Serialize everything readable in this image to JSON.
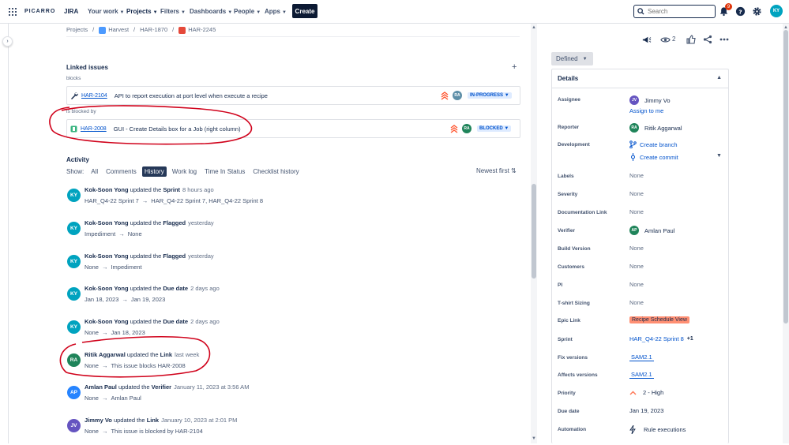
{
  "topnav": {
    "brand": "PICARRO",
    "product": "JIRA",
    "items": [
      {
        "label": "Your work"
      },
      {
        "label": "Projects"
      },
      {
        "label": "Filters"
      },
      {
        "label": "Dashboards"
      },
      {
        "label": "People"
      },
      {
        "label": "Apps"
      }
    ],
    "create_label": "Create",
    "search_placeholder": "Search",
    "notification_count": "9",
    "avatar_initials": "KY"
  },
  "breadcrumb": {
    "items": [
      "Projects",
      "Harvest",
      "HAR-1870",
      "HAR-2245"
    ]
  },
  "linked_issues": {
    "title": "Linked issues",
    "groups": [
      {
        "label": "blocks",
        "issue_key": "HAR-2104",
        "summary": "API to report execution at port level when execute a recipe",
        "assignee_initials": "RA",
        "status": "IN-PROGRESS"
      },
      {
        "label": "is blocked by",
        "issue_key": "HAR-2008",
        "summary": "GUI - Create Details box for a Job (right column)",
        "assignee_initials": "RA",
        "status": "BLOCKED"
      }
    ]
  },
  "activity": {
    "title": "Activity",
    "show_label": "Show:",
    "filters": [
      "All",
      "Comments",
      "History",
      "Work log",
      "Time In Status",
      "Checklist history"
    ],
    "active_filter": "History",
    "sort_label": "Newest first",
    "items": [
      {
        "initials": "KY",
        "color": "#00a3bf",
        "who": "Kok-Soon Yong",
        "verb": "updated the",
        "field": "Sprint",
        "when": "8 hours ago",
        "from": "HAR_Q4-22 Sprint 7",
        "to": "HAR_Q4-22 Sprint 7, HAR_Q4-22 Sprint 8"
      },
      {
        "initials": "KY",
        "color": "#00a3bf",
        "who": "Kok-Soon Yong",
        "verb": "updated the",
        "field": "Flagged",
        "when": "yesterday",
        "from": "Impediment",
        "to": "None"
      },
      {
        "initials": "KY",
        "color": "#00a3bf",
        "who": "Kok-Soon Yong",
        "verb": "updated the",
        "field": "Flagged",
        "when": "yesterday",
        "from": "None",
        "to": "Impediment"
      },
      {
        "initials": "KY",
        "color": "#00a3bf",
        "who": "Kok-Soon Yong",
        "verb": "updated the",
        "field": "Due date",
        "when": "2 days ago",
        "from": "Jan 18, 2023",
        "to": "Jan 19, 2023"
      },
      {
        "initials": "KY",
        "color": "#00a3bf",
        "who": "Kok-Soon Yong",
        "verb": "updated the",
        "field": "Due date",
        "when": "2 days ago",
        "from": "None",
        "to": "Jan 18, 2023"
      },
      {
        "initials": "RA",
        "color": "#1f845a",
        "who": "Ritik Aggarwal",
        "verb": "updated the",
        "field": "Link",
        "when": "last week",
        "from": "None",
        "to": "This issue blocks HAR-2008"
      },
      {
        "initials": "AP",
        "color": "#2684ff",
        "who": "Amlan Paul",
        "verb": "updated the",
        "field": "Verifier",
        "when": "January 11, 2023 at 3:56 AM",
        "from": "None",
        "to": "Amlan Paul"
      },
      {
        "initials": "JV",
        "color": "#6554c0",
        "who": "Jimmy Vo",
        "verb": "updated the",
        "field": "Link",
        "when": "January 10, 2023 at 2:01 PM",
        "from": "None",
        "to": "This issue is blocked by HAR-2104"
      }
    ]
  },
  "toolbar": {
    "watch_count": "2"
  },
  "status_button": {
    "label": "Defined"
  },
  "details": {
    "title": "Details",
    "assignee": {
      "label": "Assignee",
      "name": "Jimmy Vo",
      "initials": "JV",
      "assign_to_me": "Assign to me"
    },
    "reporter": {
      "label": "Reporter",
      "name": "Ritik Aggarwal",
      "initials": "RA"
    },
    "development": {
      "label": "Development",
      "create_branch": "Create branch",
      "create_commit": "Create commit"
    },
    "labels": {
      "label": "Labels",
      "value": "None"
    },
    "severity": {
      "label": "Severity",
      "value": "None"
    },
    "documentation_link": {
      "label": "Documentation Link",
      "value": "None"
    },
    "verifier": {
      "label": "Verifier",
      "name": "Amlan Paul",
      "initials": "AP"
    },
    "build_version": {
      "label": "Build Version",
      "value": "None"
    },
    "customers": {
      "label": "Customers",
      "value": "None"
    },
    "pi": {
      "label": "PI",
      "value": "None"
    },
    "tshirt": {
      "label": "T-shirt Sizing",
      "value": "None"
    },
    "epic_link": {
      "label": "Epic Link",
      "value": "Recipe Schedule View"
    },
    "sprint": {
      "label": "Sprint",
      "value": "HAR_Q4-22 Sprint 8",
      "extra": "+1"
    },
    "fix_versions": {
      "label": "Fix versions",
      "value": "SAM2.1"
    },
    "affects_versions": {
      "label": "Affects versions",
      "value": "SAM2.1"
    },
    "priority": {
      "label": "Priority",
      "value": "2 - High"
    },
    "due_date": {
      "label": "Due date",
      "value": "Jan 19, 2023"
    },
    "automation": {
      "label": "Automation",
      "value": "Rule executions"
    }
  },
  "colors": {
    "annotation_red": "#d0021b",
    "link_blue": "#0052cc",
    "inprogress": "#0052cc",
    "blocked": "#0052cc",
    "epic": "#ff8f73"
  }
}
